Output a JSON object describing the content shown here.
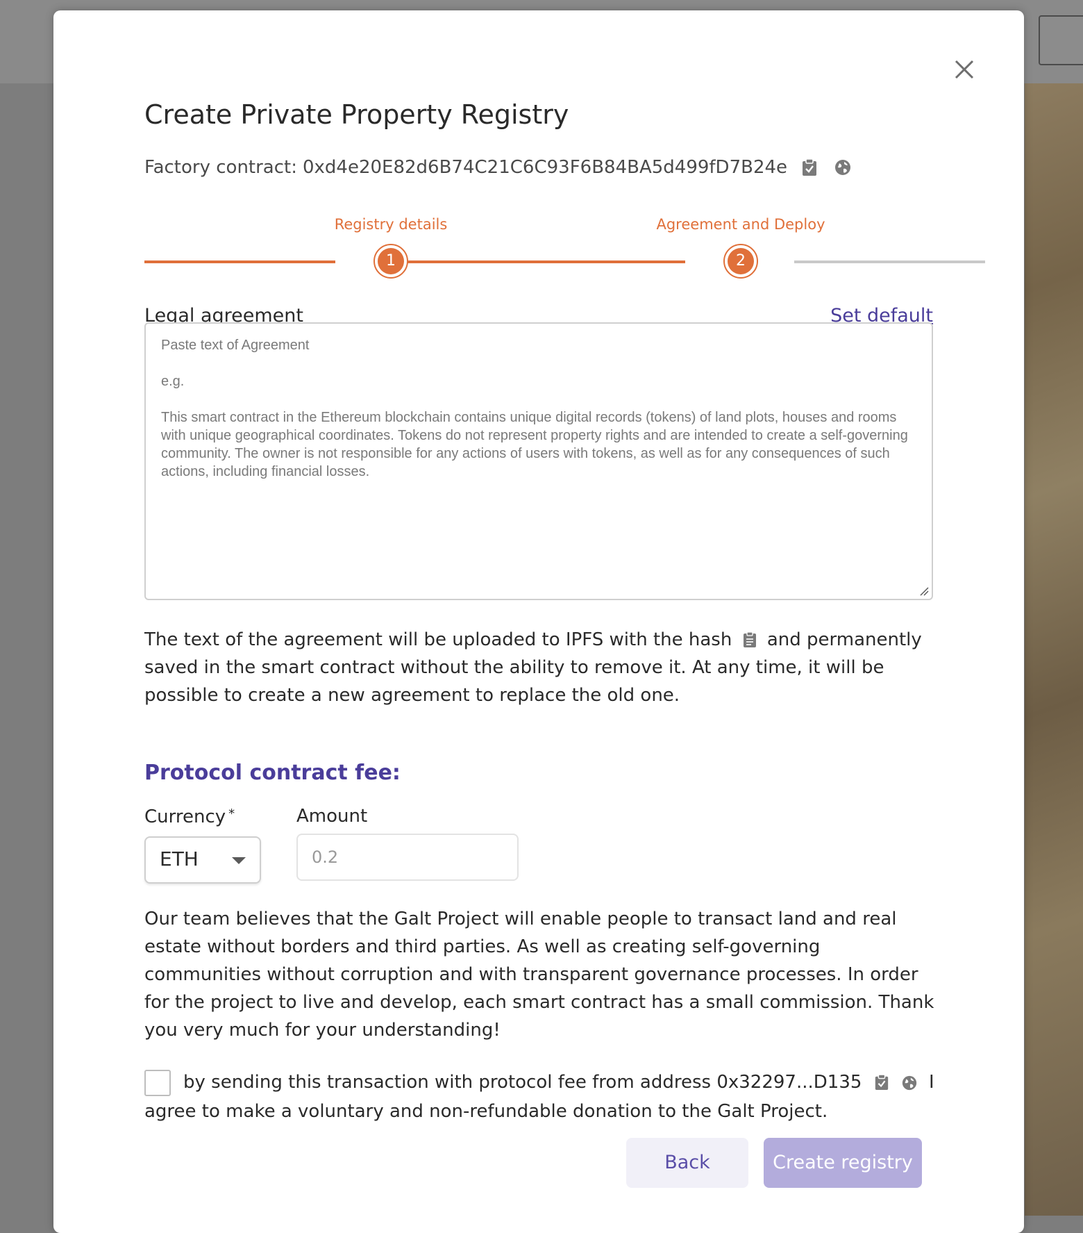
{
  "modal": {
    "title": "Create Private Property Registry",
    "factory_label": "Factory contract:",
    "factory_address": "0xd4e20E82d6B74C21C6C93F6B84BA5d499fD7B24e"
  },
  "stepper": {
    "steps": [
      {
        "label": "Registry details",
        "number": "1"
      },
      {
        "label": "Agreement and Deploy",
        "number": "2"
      }
    ],
    "active_step": 2
  },
  "agreement": {
    "label": "Legal agreement",
    "set_default": "Set default",
    "placeholder_line1": "Paste text of Agreement",
    "placeholder_line2": "e.g.",
    "placeholder_line3": "This smart contract in the Ethereum blockchain contains unique digital records (tokens) of land plots, houses and rooms with unique geographical coordinates. Tokens do not represent property rights and are intended to create a self-governing community. The owner is not responsible for any actions of users with tokens, as well as for any consequences of such actions, including financial losses.",
    "info_before_hash": "The text of the agreement will be uploaded to IPFS with the hash",
    "info_after_hash": "and permanently saved in the smart contract without the ability to remove it. At any time, it will be possible to create a new agreement to replace the old one."
  },
  "fee": {
    "title": "Protocol contract fee:",
    "currency_label": "Currency",
    "required_mark": "*",
    "currency_value": "ETH",
    "amount_label": "Amount",
    "amount_value": "0.2",
    "team_text": "Our team believes that the Galt Project will enable people to transact land and real estate without borders and third parties. As well as creating self-governing communities without corruption and with transparent governance processes. In order for the project to live and develop, each smart contract has a small commission. Thank you very much for your understanding!"
  },
  "consent": {
    "text_before": "by sending this transaction with protocol fee from address 0x32297...D135",
    "text_after": "I agree to make a voluntary and non-refundable donation to the Galt Project.",
    "checked": false
  },
  "buttons": {
    "back": "Back",
    "create": "Create registry"
  },
  "icons": {
    "close": "close-icon",
    "clipboard": "clipboard-check-icon",
    "explorer": "globe-icon",
    "hash": "clipboard-icon",
    "dropdown": "caret-down-icon"
  },
  "colors": {
    "accent_orange": "#e0703a",
    "accent_purple": "#4a3d9a",
    "create_button_disabled": "#b3acdc"
  }
}
